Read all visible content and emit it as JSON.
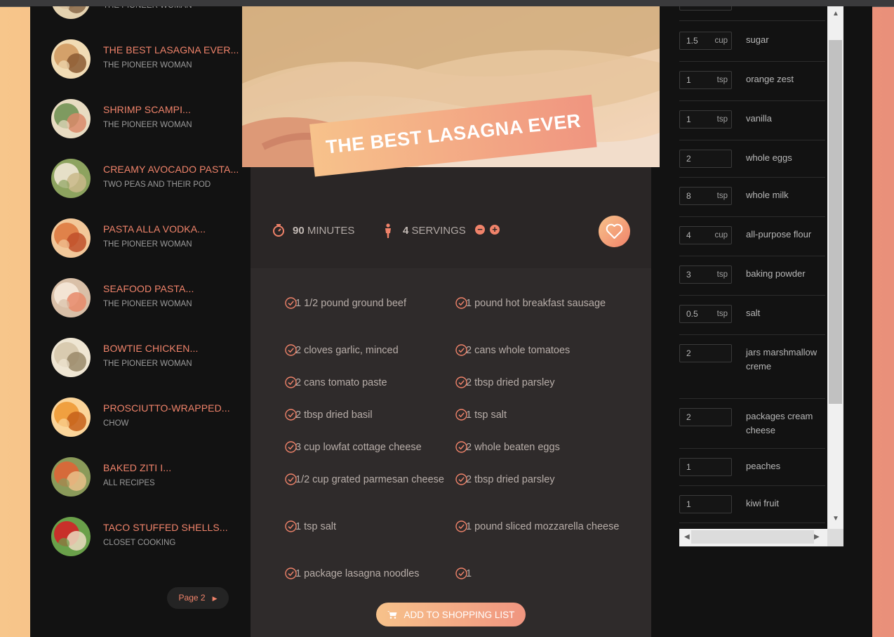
{
  "sidebar": {
    "items": [
      {
        "title": "",
        "publisher": "THE PIONEER WOMAN",
        "colors": [
          "#c9a678",
          "#8a6a4a",
          "#e4d2b0"
        ]
      },
      {
        "title": "THE BEST LASAGNA EVER...",
        "publisher": "THE PIONEER WOMAN",
        "colors": [
          "#d4a16a",
          "#8b5a33",
          "#f1dcb5"
        ]
      },
      {
        "title": "SHRIMP SCAMPI...",
        "publisher": "THE PIONEER WOMAN",
        "colors": [
          "#7e9a60",
          "#d98a6a",
          "#e8dcc2"
        ]
      },
      {
        "title": "CREAMY AVOCADO PASTA...",
        "publisher": "TWO PEAS AND THEIR POD",
        "colors": [
          "#e6e0c8",
          "#c9b98a",
          "#8da35f"
        ]
      },
      {
        "title": "PASTA ALLA VODKA...",
        "publisher": "THE PIONEER WOMAN",
        "colors": [
          "#e0824a",
          "#c0502a",
          "#f2c89a"
        ]
      },
      {
        "title": "SEAFOOD PASTA...",
        "publisher": "THE PIONEER WOMAN",
        "colors": [
          "#f3e4d4",
          "#e68a6a",
          "#d9c0a8"
        ]
      },
      {
        "title": "BOWTIE CHICKEN...",
        "publisher": "THE PIONEER WOMAN",
        "colors": [
          "#d9cbb0",
          "#9a8a6a",
          "#efe6d3"
        ]
      },
      {
        "title": "PROSCIUTTO-WRAPPED...",
        "publisher": "CHOW",
        "colors": [
          "#f0a040",
          "#c6601a",
          "#fbd59a"
        ]
      },
      {
        "title": "BAKED ZITI I...",
        "publisher": "ALL RECIPES",
        "colors": [
          "#d66a3a",
          "#e8c08a",
          "#8a9a5a"
        ]
      },
      {
        "title": "TACO STUFFED SHELLS...",
        "publisher": "CLOSET COOKING",
        "colors": [
          "#c8302a",
          "#eadac0",
          "#6aa04a"
        ]
      }
    ],
    "page_button": "Page 2"
  },
  "recipe": {
    "title": "THE BEST LASAGNA EVER",
    "time_value": "90",
    "time_unit": "MINUTES",
    "servings_value": "4",
    "servings_unit": "SERVINGS",
    "ingredients": [
      {
        "qty": "1 1/2",
        "text": "pound ground beef"
      },
      {
        "qty": "1",
        "text": "pound hot breakfast sausage"
      },
      {
        "qty": "2",
        "text": "cloves garlic, minced"
      },
      {
        "qty": "2",
        "text": "cans whole tomatoes"
      },
      {
        "qty": "2",
        "text": "cans tomato paste"
      },
      {
        "qty": "2",
        "text": "tbsp dried parsley"
      },
      {
        "qty": "2",
        "text": "tbsp dried basil"
      },
      {
        "qty": "1",
        "text": "tsp salt"
      },
      {
        "qty": "3",
        "text": "cup lowfat cottage cheese"
      },
      {
        "qty": "2",
        "text": "whole beaten eggs"
      },
      {
        "qty": "1/2",
        "text": "cup grated parmesan cheese"
      },
      {
        "qty": "2",
        "text": "tbsp dried parsley"
      },
      {
        "qty": "1",
        "text": "tsp salt"
      },
      {
        "qty": "1",
        "text": "pound sliced mozzarella cheese"
      },
      {
        "qty": "1",
        "text": "package lasagna noodles"
      },
      {
        "qty": "1",
        "text": ""
      }
    ],
    "add_button": "ADD TO SHOPPING LIST"
  },
  "shopping": {
    "items": [
      {
        "qty": "",
        "unit": "",
        "name": ""
      },
      {
        "qty": "1.5",
        "unit": "cup",
        "name": "sugar"
      },
      {
        "qty": "1",
        "unit": "tsp",
        "name": "orange zest"
      },
      {
        "qty": "1",
        "unit": "tsp",
        "name": "vanilla"
      },
      {
        "qty": "2",
        "unit": "",
        "name": "whole eggs"
      },
      {
        "qty": "8",
        "unit": "tsp",
        "name": "whole milk"
      },
      {
        "qty": "4",
        "unit": "cup",
        "name": "all-purpose flour"
      },
      {
        "qty": "3",
        "unit": "tsp",
        "name": "baking powder"
      },
      {
        "qty": "0.5",
        "unit": "tsp",
        "name": "salt"
      },
      {
        "qty": "2",
        "unit": "",
        "name": "jars marshmallow creme"
      },
      {
        "qty": "2",
        "unit": "",
        "name": "packages cream cheese"
      },
      {
        "qty": "1",
        "unit": "",
        "name": "peaches"
      },
      {
        "qty": "1",
        "unit": "",
        "name": "kiwi fruit"
      }
    ]
  },
  "colors": {
    "accent": "#f0836a",
    "background": "#121212",
    "panel": "#2a2626"
  }
}
